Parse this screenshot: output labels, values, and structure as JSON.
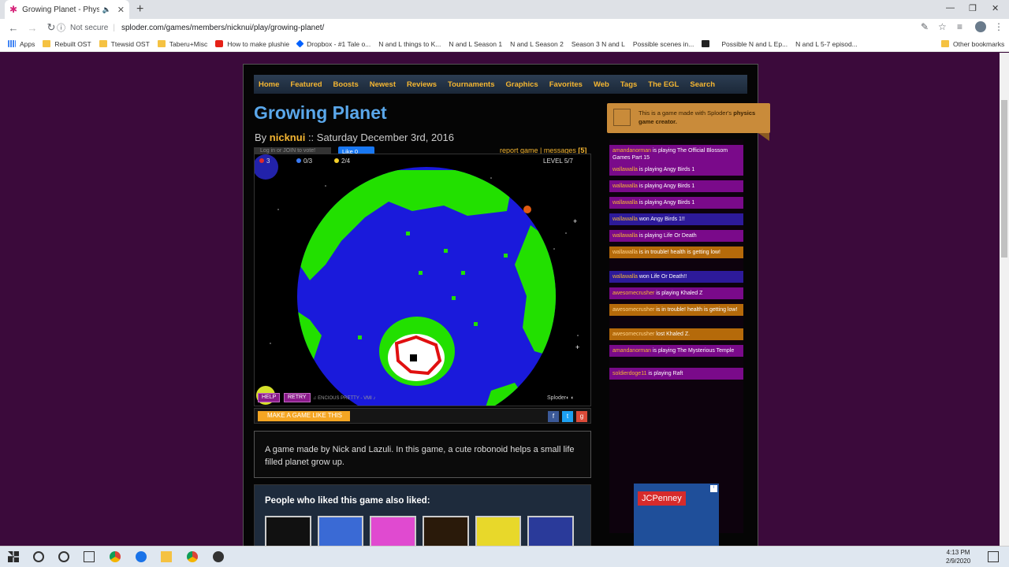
{
  "browser": {
    "tab_title": "Growing Planet - Physics Ga",
    "not_secure": "Not secure",
    "url": "sploder.com/games/members/nicknui/play/growing-planet/"
  },
  "bookmarks": [
    {
      "label": "Apps",
      "icon": "apps-icon"
    },
    {
      "label": "Rebuilt OST",
      "icon": "folder-icon"
    },
    {
      "label": "Ttewsid OST",
      "icon": "folder-icon"
    },
    {
      "label": "Taberu+Misc",
      "icon": "folder-icon"
    },
    {
      "label": "How to make plushie",
      "icon": "youtube-icon"
    },
    {
      "label": "Dropbox - #1 Tale o...",
      "icon": "dropbox-icon"
    },
    {
      "label": "N and L things to K...",
      "icon": "page-icon"
    },
    {
      "label": "N and L Season 1",
      "icon": "page-icon"
    },
    {
      "label": "N and L Season 2",
      "icon": "page-icon"
    },
    {
      "label": "Season 3 N and L",
      "icon": "page-icon"
    },
    {
      "label": "Possible scenes in...",
      "icon": "page-icon"
    },
    {
      "label": "",
      "icon": "dark-icon"
    },
    {
      "label": "Possible N and L Ep...",
      "icon": "page-icon"
    },
    {
      "label": "N and L 5-7 episod...",
      "icon": "page-icon"
    }
  ],
  "other_bookmarks": "Other bookmarks",
  "nav": [
    "Home",
    "Featured",
    "Boosts",
    "Newest",
    "Reviews",
    "Tournaments",
    "Graphics",
    "Favorites",
    "Web",
    "Tags",
    "The EGL",
    "Search"
  ],
  "game": {
    "title": "Growing Planet",
    "by": "By",
    "author": "nicknui",
    "date": ":: Saturday December 3rd, 2016",
    "vote": "Log in or JOIN to vote!",
    "like": "Like 0",
    "report": "report game | messages",
    "messages_count": "[5]",
    "hud": {
      "lives": "3",
      "blue": "0/3",
      "yellow": "2/4",
      "level": "LEVEL 5/7"
    },
    "help": "HELP",
    "retry": "RETRY",
    "credit": "♫ ENCIOUS PRETTY - VMI ♪",
    "logo": "Sploder◐ ◐",
    "make_button": "MAKE A GAME LIKE THIS",
    "description": "A game made by Nick and Lazuli. In this game, a cute robonoid helps a small life filled planet grow up."
  },
  "also_liked": "People who liked this game also liked:",
  "promo": {
    "text": "This is a game made with Sploder's",
    "bold": "physics game creator."
  },
  "feed": [
    {
      "user": "amandanorman",
      "text": " is playing The Official Blossom Games Part 15",
      "style": "purple"
    },
    {
      "user": "wallawalla",
      "text": " is playing Angy Birds 1",
      "style": "purple"
    },
    {
      "user": "wallawalla",
      "text": " is playing Angy Birds 1",
      "style": "purple"
    },
    {
      "user": "wallawalla",
      "text": " is playing Angy Birds 1",
      "style": "purple"
    },
    {
      "user": "wallawalla",
      "text": " won Angy Birds 1!!",
      "style": "blue"
    },
    {
      "user": "wallawalla",
      "text": " is playing Life Or Death",
      "style": "purple"
    },
    {
      "user": "wallawalla",
      "text": " is in trouble! health is getting low!",
      "style": "orange"
    },
    {
      "user": "wallawalla",
      "text": " won Life Or Death!!",
      "style": "blue"
    },
    {
      "user": "awesomecrusher",
      "text": " is playing Khaled Z",
      "style": "purple"
    },
    {
      "user": "awesomecrusher",
      "text": " is in trouble! health is getting low!",
      "style": "orange"
    },
    {
      "user": "awesomecrusher",
      "text": " lost Khaled Z.",
      "style": "orange"
    },
    {
      "user": "amandanorman",
      "text": " is playing The Mysterious Temple",
      "style": "purple"
    },
    {
      "user": "soldierdoge11",
      "text": " is playing Raft",
      "style": "purple"
    }
  ],
  "ad": {
    "brand": "JCPenney"
  },
  "taskbar": {
    "time": "4:13 PM",
    "date": "2/9/2020"
  }
}
